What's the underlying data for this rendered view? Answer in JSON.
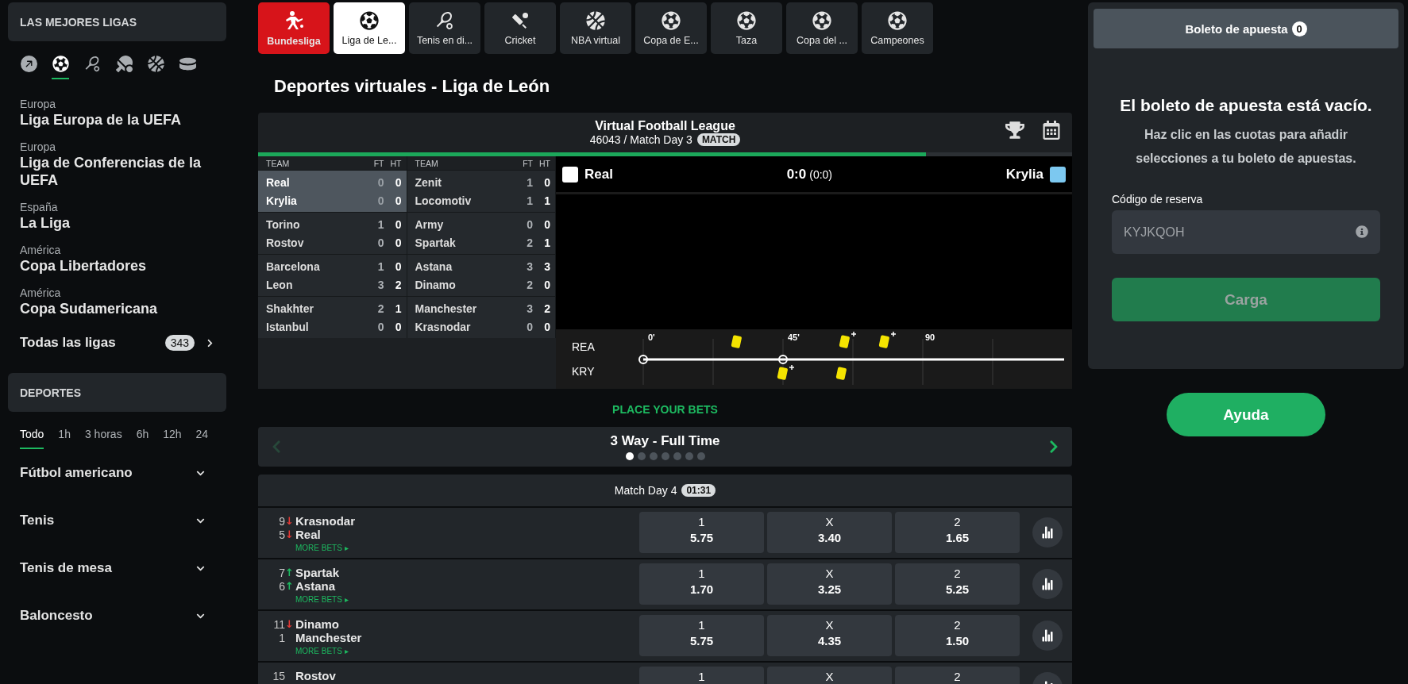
{
  "sidebar": {
    "top_leagues_title": "LAS MEJORES LIGAS",
    "sport_icons": [
      {
        "kind": "arrow",
        "selected": false
      },
      {
        "kind": "soccer",
        "selected": true
      },
      {
        "kind": "tennis",
        "selected": false
      },
      {
        "kind": "table_tennis",
        "selected": false
      },
      {
        "kind": "basketball",
        "selected": false
      },
      {
        "kind": "hockey",
        "selected": false
      }
    ],
    "leagues": [
      {
        "region": "Europa",
        "name": "Liga Europa de la UEFA"
      },
      {
        "region": "Europa",
        "name": "Liga de Conferencias de la UEFA"
      },
      {
        "region": "España",
        "name": "La Liga"
      },
      {
        "region": "América",
        "name": "Copa Libertadores"
      },
      {
        "region": "América",
        "name": "Copa Sudamericana"
      }
    ],
    "all_leagues": {
      "label": "Todas las ligas",
      "count": "343"
    },
    "sports_title": "DEPORTES",
    "time_filters": [
      {
        "label": "Todo",
        "selected": true
      },
      {
        "label": "1h",
        "selected": false
      },
      {
        "label": "3 horas",
        "selected": false
      },
      {
        "label": "6h",
        "selected": false
      },
      {
        "label": "12h",
        "selected": false
      },
      {
        "label": "24",
        "selected": false
      }
    ],
    "sports": [
      {
        "label": "Fútbol americano",
        "expanded": false
      },
      {
        "label": "Tenis",
        "expanded": false
      },
      {
        "label": "Tenis de mesa",
        "expanded": false
      },
      {
        "label": "Baloncesto",
        "expanded": false
      }
    ]
  },
  "game_tabs": [
    {
      "label": "Bundesliga",
      "kind": "bundesliga",
      "selected": false
    },
    {
      "label": "Liga de Le...",
      "kind": "soccer",
      "selected": true
    },
    {
      "label": "Tenis en di...",
      "kind": "tennis",
      "selected": false
    },
    {
      "label": "Cricket",
      "kind": "cricket",
      "selected": false
    },
    {
      "label": "NBA virtual",
      "kind": "basketball",
      "selected": false
    },
    {
      "label": "Copa de E...",
      "kind": "soccer",
      "selected": false
    },
    {
      "label": "Taza",
      "kind": "soccer",
      "selected": false
    },
    {
      "label": "Copa del ...",
      "kind": "soccer",
      "selected": false
    },
    {
      "label": "Campeones",
      "kind": "soccer",
      "selected": false
    }
  ],
  "page_title": "Deportes virtuales - Liga de León",
  "league_panel": {
    "title": "Virtual Football League",
    "subtitle": "46043 / Match Day 3",
    "badge": "MATCH",
    "progress": {
      "level": 0.82
    },
    "results_columns": [
      {
        "header_team": "TEAM",
        "header_ft": "FT",
        "header_ht": "HT",
        "matches": [
          {
            "selected": true,
            "teams": [
              {
                "name": "Real",
                "ft": "0",
                "ht": "0"
              },
              {
                "name": "Krylia",
                "ft": "0",
                "ht": "0"
              }
            ]
          },
          {
            "selected": false,
            "teams": [
              {
                "name": "Torino",
                "ft": "1",
                "ht": "0"
              },
              {
                "name": "Rostov",
                "ft": "0",
                "ht": "0"
              }
            ]
          },
          {
            "selected": false,
            "teams": [
              {
                "name": "Barcelona",
                "ft": "1",
                "ht": "0"
              },
              {
                "name": "Leon",
                "ft": "3",
                "ht": "2"
              }
            ]
          },
          {
            "selected": false,
            "teams": [
              {
                "name": "Shakhter",
                "ft": "2",
                "ht": "1"
              },
              {
                "name": "Istanbul",
                "ft": "0",
                "ht": "0"
              }
            ]
          }
        ]
      },
      {
        "header_team": "TEAM",
        "header_ft": "FT",
        "header_ht": "HT",
        "matches": [
          {
            "selected": false,
            "teams": [
              {
                "name": "Zenit",
                "ft": "1",
                "ht": "0"
              },
              {
                "name": "Locomotiv",
                "ft": "1",
                "ht": "1"
              }
            ]
          },
          {
            "selected": false,
            "teams": [
              {
                "name": "Army",
                "ft": "0",
                "ht": "0"
              },
              {
                "name": "Spartak",
                "ft": "2",
                "ht": "1"
              }
            ]
          },
          {
            "selected": false,
            "teams": [
              {
                "name": "Astana",
                "ft": "3",
                "ht": "3"
              },
              {
                "name": "Dinamo",
                "ft": "2",
                "ht": "0"
              }
            ]
          },
          {
            "selected": false,
            "teams": [
              {
                "name": "Manchester",
                "ft": "3",
                "ht": "2"
              },
              {
                "name": "Krasnodar",
                "ft": "0",
                "ht": "0"
              }
            ]
          }
        ]
      }
    ],
    "live": {
      "home": {
        "name": "Real",
        "color": "#ffffff"
      },
      "away": {
        "name": "Krylia",
        "color": "#7cc8f0"
      },
      "score": "0:0",
      "halftime": "(0:0)",
      "timeline": {
        "home_label": "REA",
        "away_label": "KRY",
        "ticks": [
          "0'",
          "45'",
          "90"
        ]
      }
    }
  },
  "bets": {
    "heading": "PLACE YOUR BETS",
    "market": {
      "title": "3 Way - Full Time",
      "prev_disabled": true,
      "pages": [
        {
          "selected": true
        },
        {
          "selected": false
        },
        {
          "selected": false
        },
        {
          "selected": false
        },
        {
          "selected": false
        },
        {
          "selected": false
        },
        {
          "selected": false
        }
      ]
    },
    "match_day": {
      "label": "Match Day 4",
      "countdown": "01:31"
    },
    "matches": [
      {
        "home": {
          "rank": "9",
          "trend": {
            "arrow": "↓",
            "color": "#e53935"
          },
          "name": "Krasnodar"
        },
        "away": {
          "rank": "5",
          "trend": {
            "arrow": "↓",
            "color": "#e53935"
          },
          "name": "Real"
        },
        "more": "MORE BETS ▸",
        "odds": [
          {
            "label": "1",
            "value": "5.75"
          },
          {
            "label": "X",
            "value": "3.40"
          },
          {
            "label": "2",
            "value": "1.65"
          }
        ]
      },
      {
        "home": {
          "rank": "7",
          "trend": {
            "arrow": "↑",
            "color": "#1db960"
          },
          "name": "Spartak"
        },
        "away": {
          "rank": "6",
          "trend": {
            "arrow": "↑",
            "color": "#1db960"
          },
          "name": "Astana"
        },
        "more": "MORE BETS ▸",
        "odds": [
          {
            "label": "1",
            "value": "1.70"
          },
          {
            "label": "X",
            "value": "3.25"
          },
          {
            "label": "2",
            "value": "5.25"
          }
        ]
      },
      {
        "home": {
          "rank": "11",
          "trend": {
            "arrow": "↓",
            "color": "#e53935"
          },
          "name": "Dinamo"
        },
        "away": {
          "rank": "1",
          "name": "Manchester"
        },
        "more": "MORE BETS ▸",
        "odds": [
          {
            "label": "1",
            "value": "5.75"
          },
          {
            "label": "X",
            "value": "4.35"
          },
          {
            "label": "2",
            "value": "1.50"
          }
        ]
      },
      {
        "home": {
          "rank": "15",
          "name": "Rostov"
        },
        "odds": [
          {
            "label": "1"
          },
          {
            "label": "X"
          },
          {
            "label": "2"
          }
        ]
      }
    ]
  },
  "betslip": {
    "tab": "Boleto de apuesta",
    "count": "0",
    "empty_title": "El boleto de apuesta está vacío.",
    "empty_text": "Haz clic en las cuotas para añadir selecciones a tu boleto de apuestas.",
    "code_label": "Código de reserva",
    "code_placeholder": "KYJKQOH",
    "load_button": {
      "label": "Carga",
      "disabled": true
    },
    "help_button": "Ayuda"
  }
}
